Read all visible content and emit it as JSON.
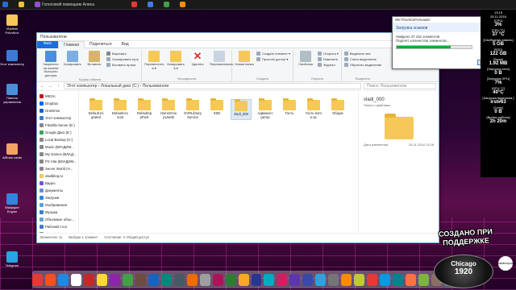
{
  "topbar": {
    "items": [
      {
        "label": "",
        "color": "#2b6ad6"
      },
      {
        "label": "",
        "color": "#f1c232"
      },
      {
        "label": "Голосовой помощник Алиса",
        "color": "#9a4ad6"
      },
      {
        "label": "",
        "color": "#e53935"
      },
      {
        "label": "",
        "color": "#3f7be0"
      },
      {
        "label": "",
        "color": "#43a047"
      },
      {
        "label": "",
        "color": "#ff8f00"
      }
    ],
    "clock": "13:15",
    "date": "26.11.2018"
  },
  "desktop_icons": [
    {
      "label": "Vladimir Polovikov",
      "color": "#f6c858"
    },
    {
      "label": "Этот компьютер",
      "color": "#3a7bd5"
    },
    {
      "label": "Панель управления",
      "color": "#4a90d9"
    },
    {
      "label": "AiRobo cards",
      "color": "#f4a261"
    },
    {
      "label": "Wallpaper Engine",
      "color": "#2e86de"
    },
    {
      "label": "Telegram",
      "color": "#2aa3e0"
    }
  ],
  "window": {
    "title": "Пользователи",
    "tabs": [
      "Файл",
      "Главная",
      "Поделиться",
      "Вид"
    ],
    "ribbon": {
      "clipboard": {
        "name": "Буфер обмена",
        "pin": "Закрепить на панели быстрого доступа",
        "copy": "Копировать",
        "paste": "Вставить",
        "cut": "Вырезать",
        "copy_path": "Скопировать путь",
        "paste_shortcut": "Вставить ярлык"
      },
      "organize": {
        "name": "Упорядочить",
        "move": "Переместить в ▾",
        "copyto": "Копировать в ▾",
        "delete": "Удалить",
        "rename": "Переименовать"
      },
      "create": {
        "name": "Создать",
        "new_folder": "Новая папка",
        "new_item": "Создать элемент ▾",
        "easy_access": "Простой доступ ▾"
      },
      "open": {
        "name": "Открыть",
        "properties": "Свойства",
        "open": "Открыть ▾",
        "edit": "Изменить",
        "history": "Журнал"
      },
      "select": {
        "name": "Выделить",
        "all": "Выделить все",
        "none": "Снять выделение",
        "invert": "Обратить выделение"
      }
    },
    "address": "Этот компьютер › Локальный диск (C:) › Пользователи",
    "search_placeholder": "Поиск: Пользователи",
    "nav_items": [
      {
        "label": "MEGA",
        "color": "#d0021b"
      },
      {
        "label": "Dropbox",
        "color": "#0061fe"
      },
      {
        "label": "OneDrive",
        "color": "#0a64c8"
      },
      {
        "label": "Этот компьютер",
        "color": "#3a7bd5"
      },
      {
        "label": "FileZilla Server (E:)",
        "color": "#888888"
      },
      {
        "label": "Google Диск (Е:)",
        "color": "#34a853"
      },
      {
        "label": "Local Backup (H:)",
        "color": "#888888"
      },
      {
        "label": "Music (ВЛАДИМ...",
        "color": "#888888"
      },
      {
        "label": "My Games (ВЛАД...",
        "color": "#888888"
      },
      {
        "label": "PS Vita (ВЛАДИМ...",
        "color": "#888888"
      },
      {
        "label": "Server World (Н...",
        "color": "#888888"
      },
      {
        "label": "vladiblog.ru",
        "color": "#f6c858"
      },
      {
        "label": "Видео",
        "color": "#7b4fd6"
      },
      {
        "label": "Документы",
        "color": "#6a8fd6"
      },
      {
        "label": "Загрузки",
        "color": "#2b8ad6"
      },
      {
        "label": "Изображения",
        "color": "#5aa0e0"
      },
      {
        "label": "Музыка",
        "color": "#3a7bd5"
      },
      {
        "label": "Объемные объе...",
        "color": "#6aa0d0"
      },
      {
        "label": "Рабочий стол",
        "color": "#3a7bd5"
      },
      {
        "label": "Студия (Владим...",
        "color": "#888888"
      },
      {
        "label": "Games (ВЛАДИМ...",
        "color": "#888888"
      },
      {
        "label": "Локальный ди...",
        "color": "#9aa0a6"
      },
      {
        "label": "Svoika HDD (D:)",
        "color": "#9aa0a6"
      }
    ],
    "files": [
      {
        "label": "Default.mi grated",
        "selected": false
      },
      {
        "label": "DefaultAcc ount",
        "selected": false
      },
      {
        "label": "DefaultAp pPool",
        "selected": false
      },
      {
        "label": "HomeGrou pUser$",
        "selected": false
      },
      {
        "label": "OVRLibrary Service",
        "selected": false
      },
      {
        "label": "SSD",
        "selected": false
      },
      {
        "label": "vladi_000",
        "selected": true
      },
      {
        "label": "Админист ратор",
        "selected": false
      },
      {
        "label": "Гость",
        "selected": false
      },
      {
        "label": "Гость.hom e-pc",
        "selected": false
      },
      {
        "label": "Общие",
        "selected": false
      }
    ],
    "preview": {
      "name": "vladi_000",
      "subtitle": "Папка с файлами",
      "date_label": "Дата изменения:",
      "date": "26.11.2018 13:28"
    },
    "status": {
      "count": "Элементов: 11",
      "selected": "Выбран 1 элемент",
      "state": "Состояние: ⚲ Общий доступ"
    }
  },
  "dialog": {
    "title": "WinThumbsPreloader",
    "heading": "Загрузка эскизов",
    "line1": "Найдено 37 152 элементов",
    "line2": "Подсчет количества элементов...",
    "progress": 0.72,
    "cancel": "Отмена"
  },
  "widget": {
    "lines": [
      {
        "label": "[CPU]",
        "value": "3%"
      },
      {
        "label": "[CPU °C]",
        "value": "37 °C"
      },
      {
        "label": "[Свободная память]",
        "value": "5 GB"
      },
      {
        "label": "[SSD]",
        "value": "122 GB"
      },
      {
        "label": "[Swap]",
        "value": "1.92 MB"
      },
      {
        "label": "[Загрузка сети]",
        "value": "0 B"
      },
      {
        "label": "[Загрузка GPU]",
        "value": "7%"
      },
      {
        "label": "[GPU °C]",
        "value": "40°C"
      },
      {
        "label": "[Загрузка видеопам.]",
        "value": "irst#63"
      },
      {
        "label": "[Сети]",
        "value": "0 B"
      },
      {
        "label": "[Время работы]",
        "value": "2h 20m"
      }
    ]
  },
  "badge": {
    "line1": "СОЗДАНО ПРИ",
    "line2": "ПОДДЕРЖКЕ"
  },
  "chicago": {
    "word": "Chicago",
    "year": "1920"
  },
  "vlogo": "vladimirpolovikov",
  "dock_colors": [
    "#e53935",
    "#f4511e",
    "#1e88e5",
    "#ffffff",
    "#c62828",
    "#fdd835",
    "#8e24aa",
    "#43a047",
    "#6d4c41",
    "#1565c0",
    "#00897b",
    "#455a64",
    "#ef6c00",
    "#9e9e9e",
    "#ad1457",
    "#2e7d32",
    "#f9a825",
    "#283593",
    "#00acc1",
    "#d81b60",
    "#5e35b1",
    "#3949ab",
    "#2aa3e0",
    "#757575",
    "#fb8c00",
    "#c0ca33",
    "#e53935",
    "#039be5",
    "#00838f",
    "#ff7043",
    "#7cb342",
    "#8d6e63",
    "#26a69a",
    "#ec407a"
  ]
}
